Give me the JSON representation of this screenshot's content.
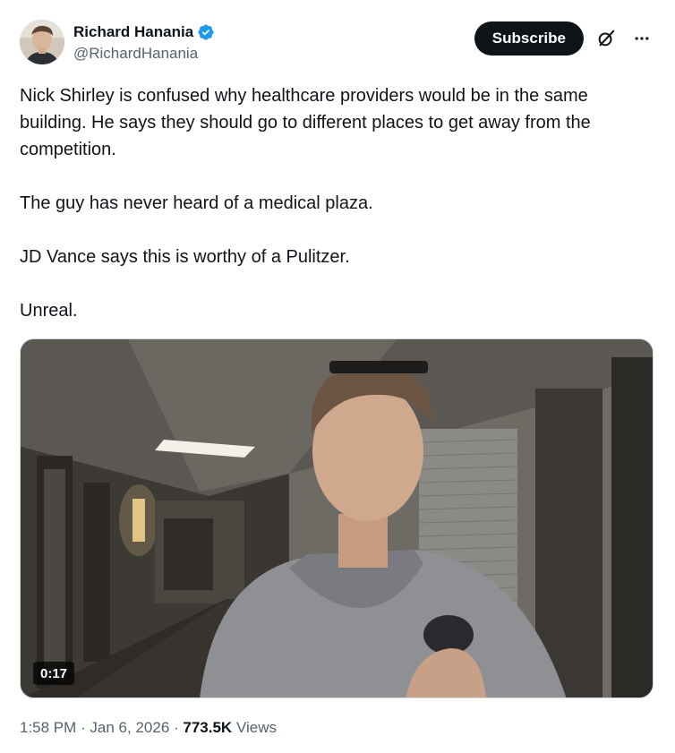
{
  "author": {
    "display_name": "Richard Hanania",
    "handle": "@RichardHanania",
    "verified": true,
    "verified_color": "#1d9bf0",
    "avatar_icon": "profile-photo"
  },
  "actions": {
    "subscribe_label": "Subscribe",
    "grok_icon": "grok-icon",
    "more_icon": "more-options-icon"
  },
  "tweet": {
    "paragraphs": [
      "Nick Shirley is confused why healthcare providers would be in the same building. He says they should go to different places to get away from the competition.",
      "The guy has never heard of a medical plaza.",
      "JD Vance says this is worthy of a Pulitzer.",
      "Unreal."
    ]
  },
  "media": {
    "type": "video",
    "duration": "0:17"
  },
  "meta": {
    "time": "1:58 PM",
    "separator1": " · ",
    "date": "Jan 6, 2026",
    "separator2": " · ",
    "views_count": "773.5K",
    "views_label": " Views"
  },
  "colors": {
    "text_primary": "#0f1419",
    "text_secondary": "#536471",
    "button_bg": "#0f1419",
    "border": "#cfd9de"
  }
}
